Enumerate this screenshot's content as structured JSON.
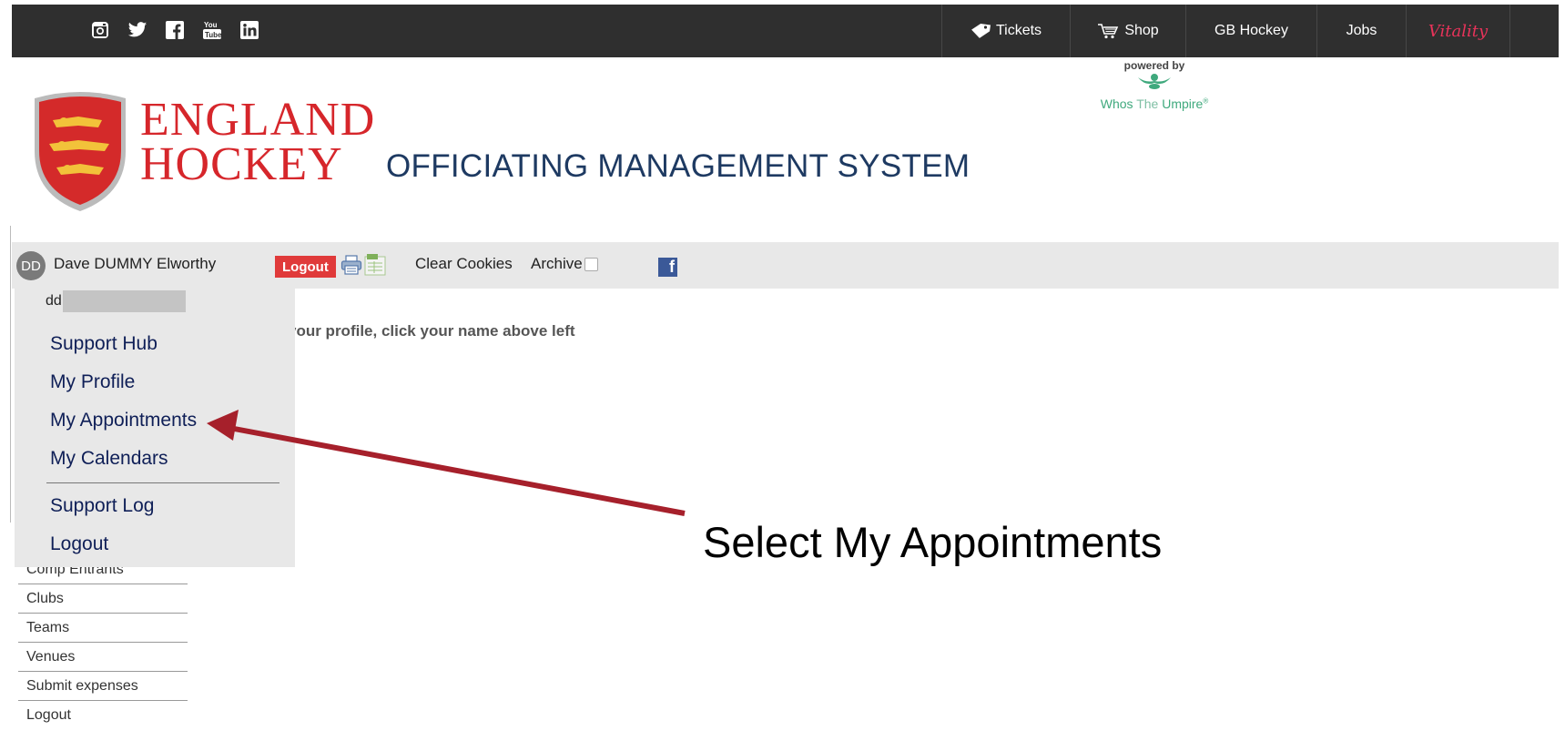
{
  "topbar": {
    "social": [
      {
        "icon": "instagram-icon"
      },
      {
        "icon": "twitter-icon"
      },
      {
        "icon": "facebook-icon"
      },
      {
        "icon": "youtube-icon",
        "label": "You Tube"
      },
      {
        "icon": "linkedin-icon"
      }
    ],
    "nav": [
      {
        "label": "Tickets",
        "icon": "ticket-icon"
      },
      {
        "label": "Shop",
        "icon": "cart-icon"
      },
      {
        "label": "GB Hockey"
      },
      {
        "label": "Jobs"
      },
      {
        "label": "Vitality"
      }
    ]
  },
  "banner": {
    "brand_line1": "ENGLAND",
    "brand_line2": "HOCKEY",
    "subtitle": "OFFICIATING MANAGEMENT SYSTEM",
    "powered_by": "powered by",
    "partner_part1": "Whos ",
    "partner_part2": "The",
    "partner_part3": " Umpire",
    "partner_mark": "®"
  },
  "userbar": {
    "avatar_initials": "DD",
    "username": "Dave DUMMY Elworthy",
    "logout_label": "Logout",
    "clear_cookies_label": "Clear Cookies",
    "archive_label": "Archive",
    "facebook_glyph": "f"
  },
  "hint": "your profile, click your name above left",
  "dropdown": {
    "email_visible": "dd",
    "items": [
      {
        "label": "Support Hub"
      },
      {
        "label": "My Profile"
      },
      {
        "label": "My Appointments"
      },
      {
        "label": "My Calendars"
      },
      {
        "label": "Support Log"
      },
      {
        "label": "Logout"
      }
    ]
  },
  "sidenav": {
    "items": [
      {
        "label": "Comp Entrants"
      },
      {
        "label": "Clubs"
      },
      {
        "label": "Teams"
      },
      {
        "label": "Venues"
      },
      {
        "label": "Submit expenses"
      },
      {
        "label": "Logout"
      }
    ]
  },
  "annotation": {
    "text": "Select My Appointments",
    "arrow_color": "#a6202b"
  },
  "colors": {
    "topbar_bg": "#2f2f2f",
    "brand_red": "#d6262b",
    "subtitle_navy": "#1e3a62",
    "logout_red": "#e03a3a",
    "menu_navy": "#0f1f57",
    "partner_green": "#3fa97d"
  }
}
